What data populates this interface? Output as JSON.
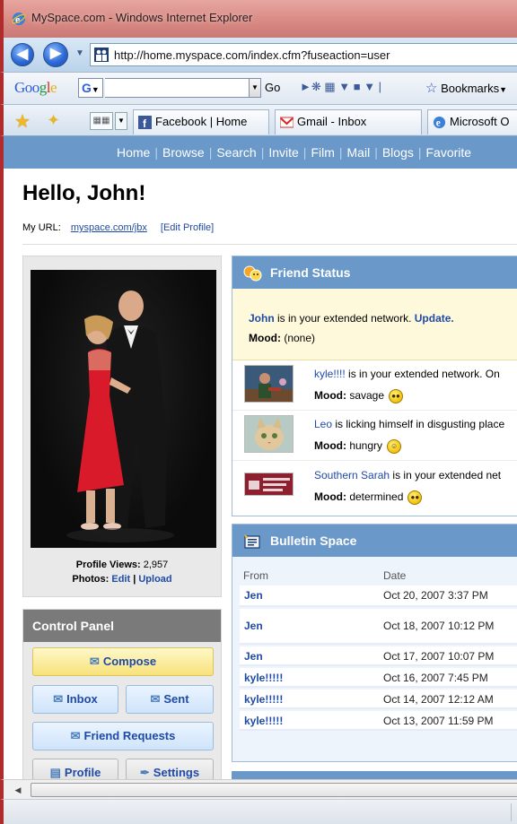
{
  "window": {
    "title": "MySpace.com - Windows Internet Explorer",
    "address": "http://home.myspace.com/index.cfm?fuseaction=user"
  },
  "google_toolbar": {
    "logo_b": "Goo",
    "logo_g": "g",
    "logo_l": "l",
    "logo_e": "e",
    "g_label": "G",
    "go_label": "Go",
    "bookmarks_label": "Bookmarks"
  },
  "tabs": [
    {
      "label": "Facebook | Home"
    },
    {
      "label": "Gmail - Inbox"
    },
    {
      "label": "Microsoft O"
    }
  ],
  "nav": {
    "items": [
      "Home",
      "Browse",
      "Search",
      "Invite",
      "Film",
      "Mail",
      "Blogs",
      "Favorite"
    ],
    "separator": "|"
  },
  "header": {
    "greeting": "Hello, John!",
    "url_label": "My URL:",
    "url_value": "myspace.com/jbx",
    "edit_profile": "[Edit Profile]"
  },
  "profile": {
    "views_label": "Profile Views:",
    "views_value": "2,957",
    "photos_label": "Photos:",
    "edit": "Edit",
    "pipe": "|",
    "upload": "Upload"
  },
  "control_panel": {
    "title": "Control Panel",
    "compose": "Compose",
    "inbox": "Inbox",
    "sent": "Sent",
    "friend_requests": "Friend Requests",
    "profile": "Profile",
    "settings": "Settings"
  },
  "friend_status": {
    "title": "Friend Status",
    "self_name": "John",
    "self_text": " is in your extended network. ",
    "update": "Update.",
    "self_mood_label": "Mood:",
    "self_mood": "(none)",
    "rows": [
      {
        "name": "kyle!!!!",
        "text": " is in your extended network. On",
        "mood_label": "Mood:",
        "mood": "savage"
      },
      {
        "name": "Leo",
        "text": " is licking himself in disgusting place",
        "mood_label": "Mood:",
        "mood": "hungry"
      },
      {
        "name": "Southern Sarah",
        "text": " is in your extended net",
        "mood_label": "Mood:",
        "mood": "determined"
      }
    ]
  },
  "bulletin": {
    "title": "Bulletin Space",
    "col_from": "From",
    "col_date": "Date",
    "rows": [
      {
        "from": "Jen",
        "date": "Oct 20, 2007 3:37 PM"
      },
      {
        "from": "Jen",
        "date": "Oct 18, 2007 10:12 PM"
      },
      {
        "from": "Jen",
        "date": "Oct 17, 2007 10:07 PM"
      },
      {
        "from": "kyle!!!!!",
        "date": "Oct 16, 2007 7:45 PM"
      },
      {
        "from": "kyle!!!!!",
        "date": "Oct 14, 2007 12:12 AM"
      },
      {
        "from": "kyle!!!!!",
        "date": "Oct 13, 2007 11:59 PM"
      }
    ]
  },
  "colors": {
    "myspace_blue": "#6a98c9",
    "link_blue": "#1f4aa5",
    "window_frame": "#b02c2c"
  }
}
